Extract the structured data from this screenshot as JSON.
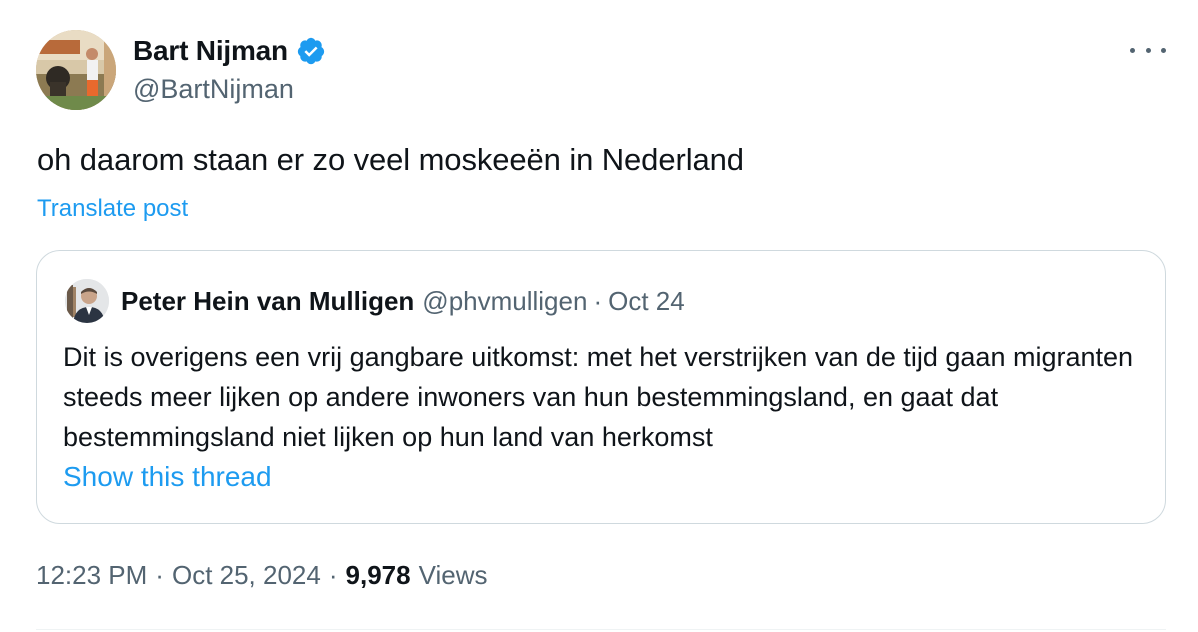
{
  "author": {
    "display_name": "Bart Nijman",
    "handle": "@BartNijman",
    "verified_icon": "verified-badge-icon",
    "verified_color": "#1d9bf0"
  },
  "post": {
    "text": "oh daarom staan er zo veel moskeeën in Nederland",
    "translate_label": "Translate post"
  },
  "quoted_post": {
    "display_name": "Peter Hein van Mulligen",
    "handle": "@phvmulligen",
    "separator": "·",
    "date": "Oct 24",
    "text": "Dit is overigens een vrij gangbare uitkomst: met het verstrijken van de tijd gaan migranten steeds meer lijken op andere inwoners van hun bestemmingsland, en gaat dat bestemmingsland niet lijken op hun land van herkomst",
    "show_thread_label": "Show this thread"
  },
  "meta": {
    "time": "12:23 PM",
    "separator": "·",
    "date": "Oct 25, 2024",
    "views_count": "9,978",
    "views_label": "Views"
  },
  "more_icon": "more-options-icon",
  "colors": {
    "link": "#1d9bf0",
    "secondary_text": "#536471",
    "primary_text": "#0f1419",
    "border": "#cfd9de"
  }
}
